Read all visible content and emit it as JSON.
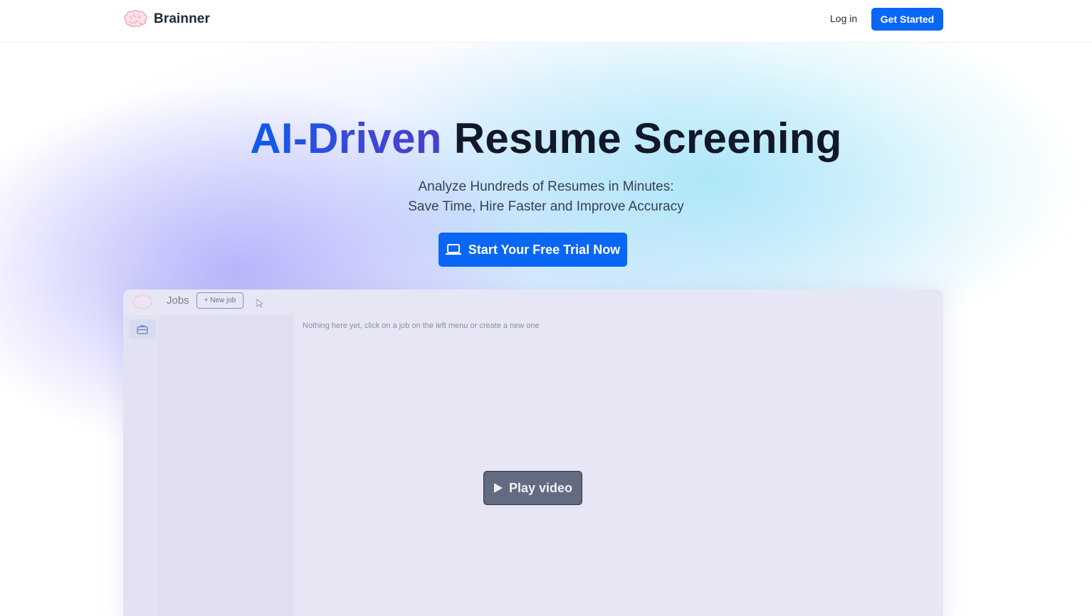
{
  "header": {
    "brand_name": "Brainner",
    "login_label": "Log in",
    "get_started_label": "Get Started"
  },
  "hero": {
    "title_accent": "AI-Driven",
    "title_rest": "Resume Screening",
    "subtitle_line1": "Analyze Hundreds of Resumes in Minutes:",
    "subtitle_line2": "Save Time, Hire Faster and Improve Accuracy",
    "cta_label": "Start Your Free Trial Now",
    "cta_icon": "laptop-icon"
  },
  "preview": {
    "section_title": "Jobs",
    "new_job_label": "+ New job",
    "empty_message": "Nothing here yet, click on a job on the left menu or create a new one",
    "rail_icon": "briefcase-icon",
    "play_label": "Play video",
    "play_icon": "play-icon"
  },
  "colors": {
    "primary": "#0a66f5",
    "accent_gradient_start": "#0b5cf0",
    "accent_gradient_end": "#4a3fc9",
    "play_button": "#636b80"
  }
}
